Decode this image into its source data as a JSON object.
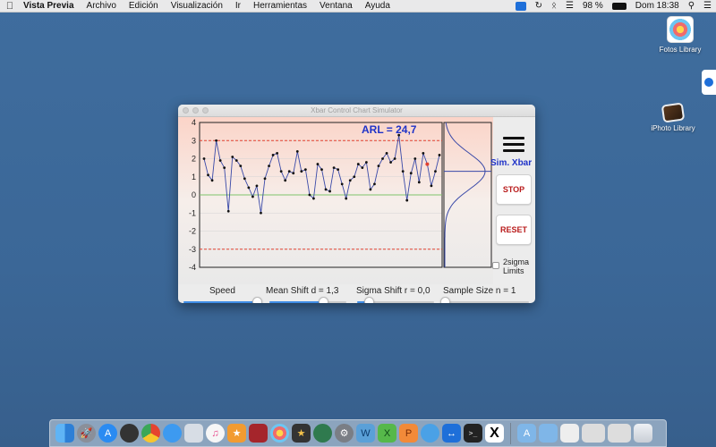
{
  "menubar": {
    "app_name": "Vista Previa",
    "items": [
      "Archivo",
      "Edición",
      "Visualización",
      "Ir",
      "Herramientas",
      "Ventana",
      "Ayuda"
    ],
    "battery": "98 %",
    "clock": "Dom 18:38"
  },
  "desktop": {
    "icons": [
      {
        "label": "Fotos Library"
      },
      {
        "label": "iPhoto Library"
      }
    ]
  },
  "window": {
    "title": "Xbar Control Chart Simulator",
    "arl_label": "ARL = 24,7",
    "sim_label": "Sim. Xbar",
    "stop_label": "STOP",
    "reset_label": "RESET",
    "checkbox_label_line1": "2sigma",
    "checkbox_label_line2": "Limits",
    "sliders": [
      {
        "label": "Speed",
        "value": 0.95
      },
      {
        "label": "Mean Shift d = 1,3",
        "value": 0.7
      },
      {
        "label": "Sigma Shift r = 0,0",
        "value": 0.15
      },
      {
        "label": "Sample Size n = 1",
        "value": 0.0
      }
    ]
  },
  "colors": {
    "accent_blue": "#1f33c8",
    "stop_red": "#b91c1c",
    "control_limit": "#e0402f",
    "center_line": "#7ec46b",
    "series": "#3949a8"
  },
  "chart_data": {
    "type": "line",
    "title": "ARL = 24,7",
    "xlabel": "",
    "ylabel": "",
    "ylim": [
      -4,
      4
    ],
    "y_ticks": [
      "4",
      "3",
      "2",
      "1",
      "0",
      "-1",
      "-2",
      "-3",
      "-4"
    ],
    "ucl": 3,
    "lcl": -3,
    "center": 0,
    "highlight_index": 55,
    "values": [
      2.0,
      1.1,
      0.8,
      3.0,
      1.9,
      1.5,
      -0.9,
      2.1,
      1.9,
      1.6,
      0.9,
      0.4,
      -0.1,
      0.5,
      -1.0,
      0.9,
      1.6,
      2.2,
      2.3,
      1.3,
      0.8,
      1.3,
      1.2,
      2.4,
      1.3,
      1.4,
      0.0,
      -0.2,
      1.7,
      1.4,
      0.3,
      0.2,
      1.5,
      1.4,
      0.6,
      -0.2,
      0.8,
      1.0,
      1.7,
      1.5,
      1.8,
      0.3,
      0.6,
      1.6,
      2.0,
      2.3,
      1.8,
      2.0,
      3.3,
      1.3,
      -0.3,
      1.2,
      2.0,
      0.7,
      2.3,
      1.7,
      0.5,
      1.3,
      2.2
    ],
    "distribution": {
      "mean": 1.3,
      "sd": 1.0
    }
  }
}
